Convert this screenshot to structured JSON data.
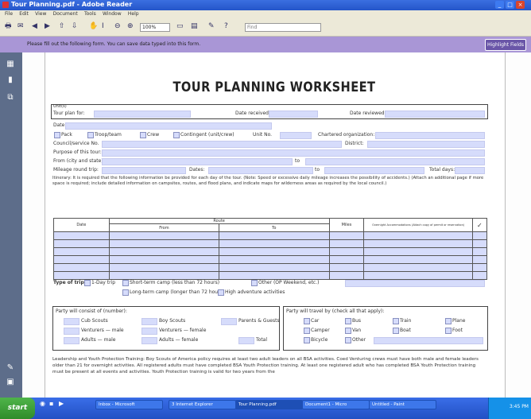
{
  "window": {
    "title": "Tour Planning.pdf - Adobe Reader",
    "controls": [
      "_",
      "□",
      "×"
    ]
  },
  "menu": [
    "File",
    "Edit",
    "View",
    "Document",
    "Tools",
    "Window",
    "Help"
  ],
  "toolbar": {
    "zoom": "100%",
    "find_placeholder": "Find"
  },
  "formbar": {
    "message": "Please fill out the following form. You can save data typed into this form.",
    "highlight_button": "Highlight Fields"
  },
  "document": {
    "title": "TOUR PLANNING WORKSHEET",
    "fields": {
      "unit_row_top": "Unit(s)",
      "tour_plan_for": "Tour plan for:",
      "date_received": "Date received:",
      "date_reviewed": "Date reviewed:",
      "date": "Date:",
      "pack": "Pack",
      "troop": "Troop/team",
      "crew": "Crew",
      "contingent": "Contingent (unit/crew)",
      "unit_no": "Unit No.",
      "chartered_org": "Chartered organization:",
      "council": "Council/service No.",
      "district": "District:",
      "purpose": "Purpose of this tour:",
      "from_dates": "From (city and state):",
      "to": "to",
      "mileage": "Mileage round trip:",
      "dates": "Dates:",
      "to2": "to",
      "total_days": "Total days:"
    },
    "itinerary_text": "Itinerary: It is required that the following information be provided for each day of the tour. (Note: Speed or excessive daily mileage increases the possibility of accidents.) (Attach an additional page if more space is required; include detailed information on campsites, routes, and flood plans, and indicate maps for wilderness areas as required by the local council.)",
    "table": {
      "headers": [
        "Date",
        "Route",
        "Miles",
        "Overnight Accommodations (Attach copy of permit or reservation)",
        "✓"
      ],
      "subheaders": [
        "From",
        "To"
      ]
    },
    "trip_type": {
      "label": "Type of trip:",
      "options": [
        "1-Day trip",
        "Short-term camp (less than 72 hours)",
        "Other (OP Weekend, etc.)",
        "Long-term camp (longer than 72 hours)",
        "High adventure activities"
      ]
    },
    "party_count": {
      "title": "Party will consist of (number):",
      "items": [
        "Cub Scouts",
        "Boy Scouts",
        "Parents & Guests",
        "Venturers — male",
        "Venturers — female",
        "Adults — male",
        "Adults — female",
        "Total"
      ]
    },
    "travel": {
      "title": "Party will travel by (check all that apply):",
      "modes": [
        "Car",
        "Bus",
        "Train",
        "Plane",
        "Camper",
        "Van",
        "Boat",
        "Foot",
        "Bicycle",
        "Other"
      ]
    },
    "leadership_text": "Leadership and Youth Protection Training: Boy Scouts of America policy requires at least two adult leaders on all BSA activities. Coed Venturing crews must have both male and female leaders older than 21 for overnight activities. All registered adults must have completed BSA Youth Protection training. At least one registered adult who has completed BSA Youth Protection training must be present at all events and activities. Youth Protection training is valid for two years from the"
  },
  "taskbar": {
    "start": "start",
    "tasks": [
      "Inbox - Microsoft",
      "3 Internet Explorer",
      "Tour Planning.pdf",
      "Document1 - Micro",
      "Untitled - Paint"
    ],
    "clock": "3:45 PM"
  }
}
